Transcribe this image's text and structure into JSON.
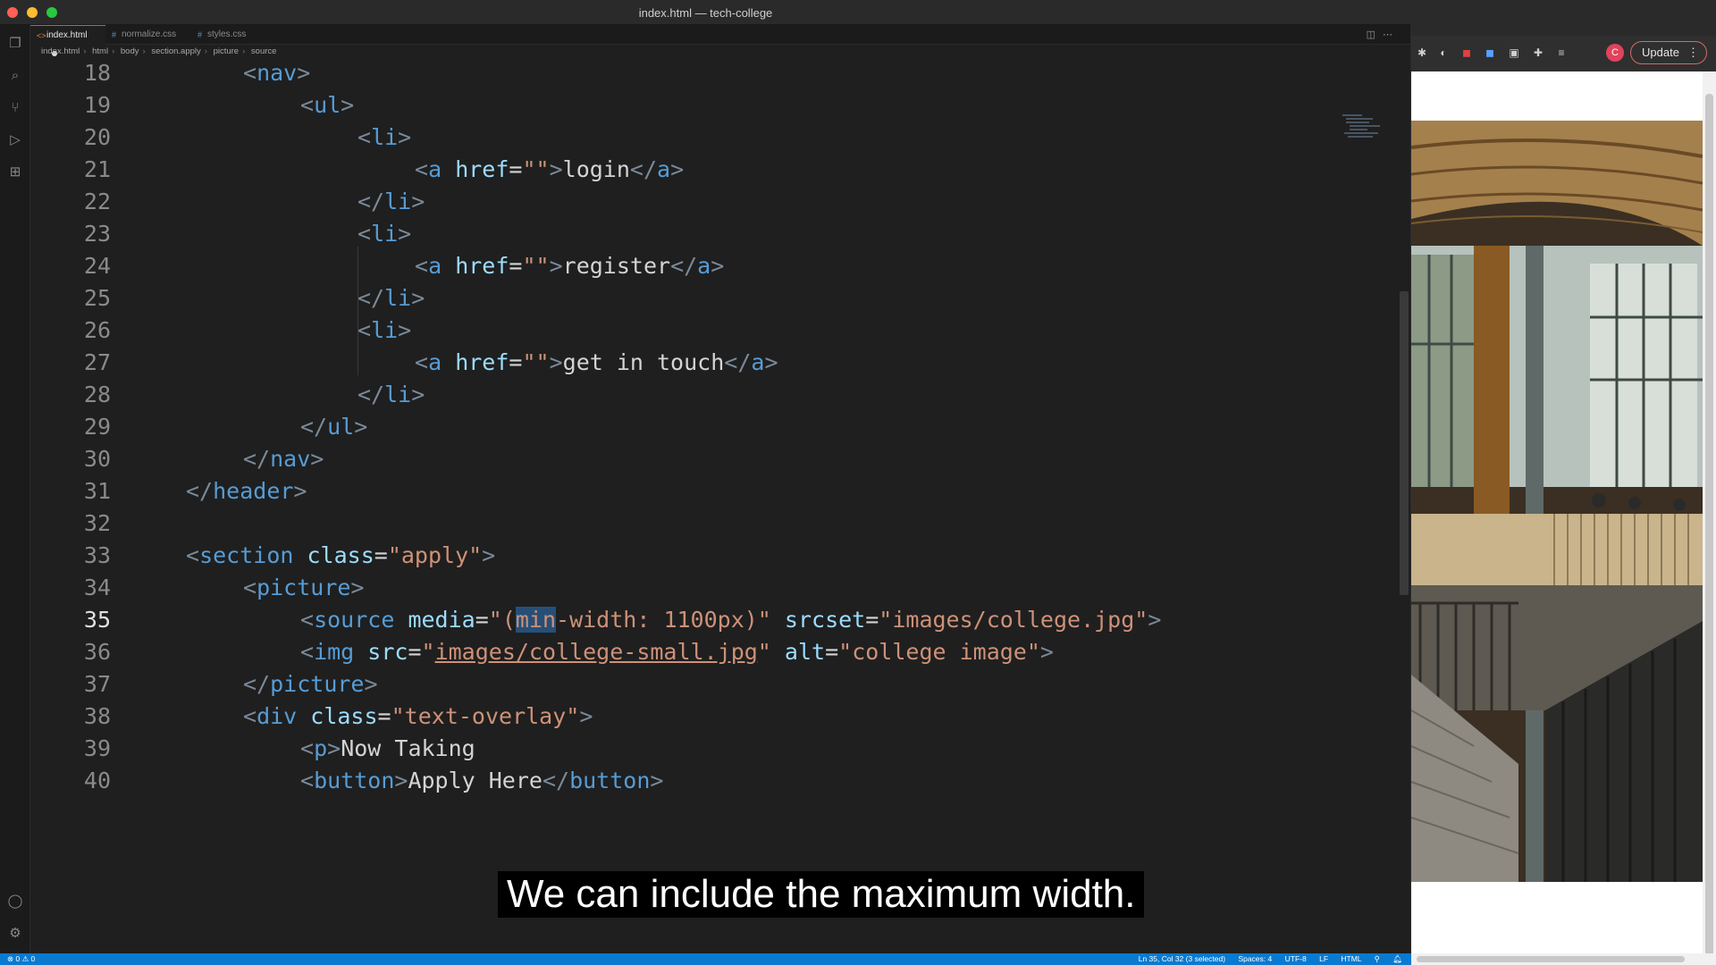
{
  "window": {
    "title": "index.html — tech-college"
  },
  "tabs": [
    {
      "label": "index.html",
      "active": true,
      "modified": true
    },
    {
      "label": "normalize.css",
      "active": false
    },
    {
      "label": "styles.css",
      "active": false
    }
  ],
  "breadcrumbs": [
    "index.html",
    "html",
    "body",
    "section.apply",
    "picture",
    "source"
  ],
  "editor": {
    "current_line": 35,
    "line_numbers": [
      "18",
      "19",
      "20",
      "21",
      "22",
      "23",
      "24",
      "25",
      "26",
      "27",
      "28",
      "29",
      "30",
      "31",
      "32",
      "33",
      "34",
      "35",
      "36",
      "37",
      "38",
      "39",
      "40"
    ]
  },
  "code": {
    "l18": {
      "open": "<",
      "tag": "nav",
      "close": ">"
    },
    "l19": {
      "open": "<",
      "tag": "ul",
      "close": ">"
    },
    "l20": {
      "open": "<",
      "tag": "li",
      "close": ">"
    },
    "l21": {
      "open": "<",
      "tag": "a",
      "attr": "href",
      "eq": "=",
      "val": "\"\"",
      "gt": ">",
      "text": "login",
      "close_open": "</",
      "close_tag": "a",
      "close_gt": ">"
    },
    "l22": {
      "open": "</",
      "tag": "li",
      "close": ">"
    },
    "l23": {
      "open": "<",
      "tag": "li",
      "close": ">"
    },
    "l24": {
      "open": "<",
      "tag": "a",
      "attr": "href",
      "eq": "=",
      "val": "\"\"",
      "gt": ">",
      "text": "register",
      "close_open": "</",
      "close_tag": "a",
      "close_gt": ">"
    },
    "l25": {
      "open": "</",
      "tag": "li",
      "close": ">"
    },
    "l26": {
      "open": "<",
      "tag": "li",
      "close": ">"
    },
    "l27": {
      "open": "<",
      "tag": "a",
      "attr": "href",
      "eq": "=",
      "val": "\"\"",
      "gt": ">",
      "text": "get in touch",
      "close_open": "</",
      "close_tag": "a",
      "close_gt": ">"
    },
    "l28": {
      "open": "</",
      "tag": "li",
      "close": ">"
    },
    "l29": {
      "open": "</",
      "tag": "ul",
      "close": ">"
    },
    "l30": {
      "open": "</",
      "tag": "nav",
      "close": ">"
    },
    "l31": {
      "open": "</",
      "tag": "header",
      "close": ">"
    },
    "l33": {
      "open": "<",
      "tag": "section",
      "attr": "class",
      "eq": "=",
      "val": "\"apply\"",
      "close": ">"
    },
    "l34": {
      "open": "<",
      "tag": "picture",
      "close": ">"
    },
    "l35": {
      "open": "<",
      "tag": "source",
      "attr1": "media",
      "eq1": "=",
      "val1_a": "\"(",
      "val1_sel": "min",
      "val1_b": "-width: 1100px)\"",
      "attr2": "srcset",
      "eq2": "=",
      "val2": "\"images/college.jpg\"",
      "close": ">"
    },
    "l36": {
      "open": "<",
      "tag": "img",
      "attr1": "src",
      "eq1": "=",
      "q1": "\"",
      "val1": "images/college-small.jpg",
      "q2": "\"",
      "attr2": "alt",
      "eq2": "=",
      "val2": "\"college image\"",
      "close": ">"
    },
    "l37": {
      "open": "</",
      "tag": "picture",
      "close": ">"
    },
    "l38": {
      "open": "<",
      "tag": "div",
      "attr": "class",
      "eq": "=",
      "val": "\"text-overlay\"",
      "close": ">"
    },
    "l39": {
      "open": "<",
      "tag": "p",
      "close": ">",
      "text": "Now Taking"
    },
    "l40": {
      "open": "<",
      "tag": "button",
      "close": ">",
      "text": "Apply Here",
      "close_open": "</",
      "close_tag": "button",
      "close_gt": ">"
    }
  },
  "status_bar": {
    "problems": "⊗ 0 ⚠ 0",
    "cursor": "Ln 35, Col 32 (3 selected)",
    "spaces": "Spaces: 4",
    "encoding": "UTF-8",
    "eol": "LF",
    "language": "HTML"
  },
  "browser": {
    "update_label": "Update",
    "avatar_initial": "C"
  },
  "caption": "We can include the maximum width.",
  "colors": {
    "tag": "#569cd6",
    "attr": "#9cdcfe",
    "string": "#ce9178",
    "status_bar": "#0a7ad1"
  }
}
